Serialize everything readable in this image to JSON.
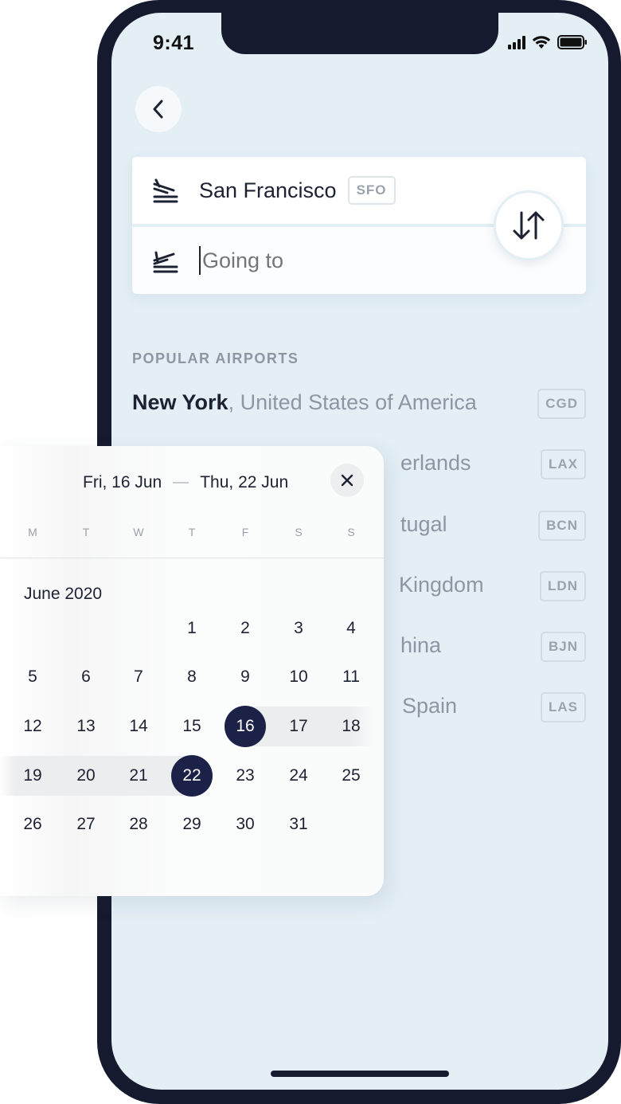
{
  "status_bar": {
    "time": "9:41"
  },
  "route": {
    "from_city": "San Francisco",
    "from_code": "SFO",
    "to_placeholder": "Going to"
  },
  "popular": {
    "title": "POPULAR AIRPORTS",
    "items": [
      {
        "city": "New York",
        "country": ", United States of America",
        "code": "CGD"
      },
      {
        "visible_text": "erlands",
        "code": "LAX"
      },
      {
        "visible_text": "tugal",
        "code": "BCN"
      },
      {
        "visible_text": "Kingdom",
        "code": "LDN"
      },
      {
        "visible_text": "hina",
        "code": "BJN"
      },
      {
        "visible_text": "Spain",
        "code": "LAS"
      }
    ]
  },
  "calendar": {
    "start_label": "Fri, 16 Jun",
    "end_label": "Thu, 22 Jun",
    "weekdays": [
      "M",
      "T",
      "W",
      "T",
      "F",
      "S",
      "S"
    ],
    "month_label": "June 2020",
    "first_weekday_index": 3,
    "days_in_month": 31,
    "range_start": 16,
    "range_end": 22
  },
  "colors": {
    "accent": "#1c2147",
    "screen_bg": "#e3eef5",
    "range_bg": "#ecedef"
  },
  "icons": {
    "back": "chevron-left-icon",
    "plane": "plane-icon",
    "swap": "swap-arrows-icon",
    "close": "close-icon"
  }
}
